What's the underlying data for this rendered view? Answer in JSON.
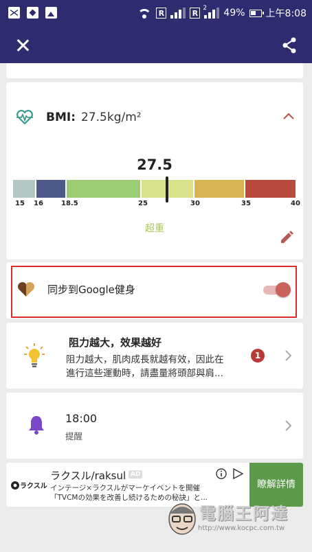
{
  "status_bar": {
    "r1": "R",
    "r2": "R",
    "sim_index": "2",
    "battery": "49%",
    "time": "上午8:08"
  },
  "app_bar": {
    "close_icon": "close-icon",
    "share_icon": "share-icon"
  },
  "bmi": {
    "label": "BMI:",
    "value": "27.5kg/m²",
    "big_value": "27.5",
    "current": 27.5,
    "ticks": [
      "15",
      "16",
      "18.5",
      "25",
      "30",
      "35",
      "40"
    ],
    "segment_colors": [
      "#b2c7c4",
      "#4e5a8a",
      "#9bcc73",
      "#d7e28a",
      "#d6b44f",
      "#b94a3c"
    ],
    "category": "超重",
    "category_color": "#a9c95a"
  },
  "sync": {
    "label": "同步到Google健身",
    "toggle_on": true,
    "accent": "#c9625b"
  },
  "tip": {
    "title": "阻力越大，效果越好",
    "line1": "阻力越大，肌肉成長就越有效，因此在",
    "line2": "進行這些運動時，請盡量將頭部與肩...",
    "badge": "1"
  },
  "reminder": {
    "time": "18:00",
    "label": "提醒"
  },
  "ad": {
    "logo_text": "ラクスル",
    "title": "ラクスル/raksul",
    "badge": "AD",
    "line1": "インテージ×ラクスルがマーケイベントを開催",
    "line2": "「TVCMの効果を改善し続けるための秘訣」と...",
    "cta": "瞭解詳情",
    "cta_color": "#5a9a48"
  },
  "watermark": {
    "title": "電腦王阿達",
    "url": "http://www.kocpc.com.tw"
  }
}
